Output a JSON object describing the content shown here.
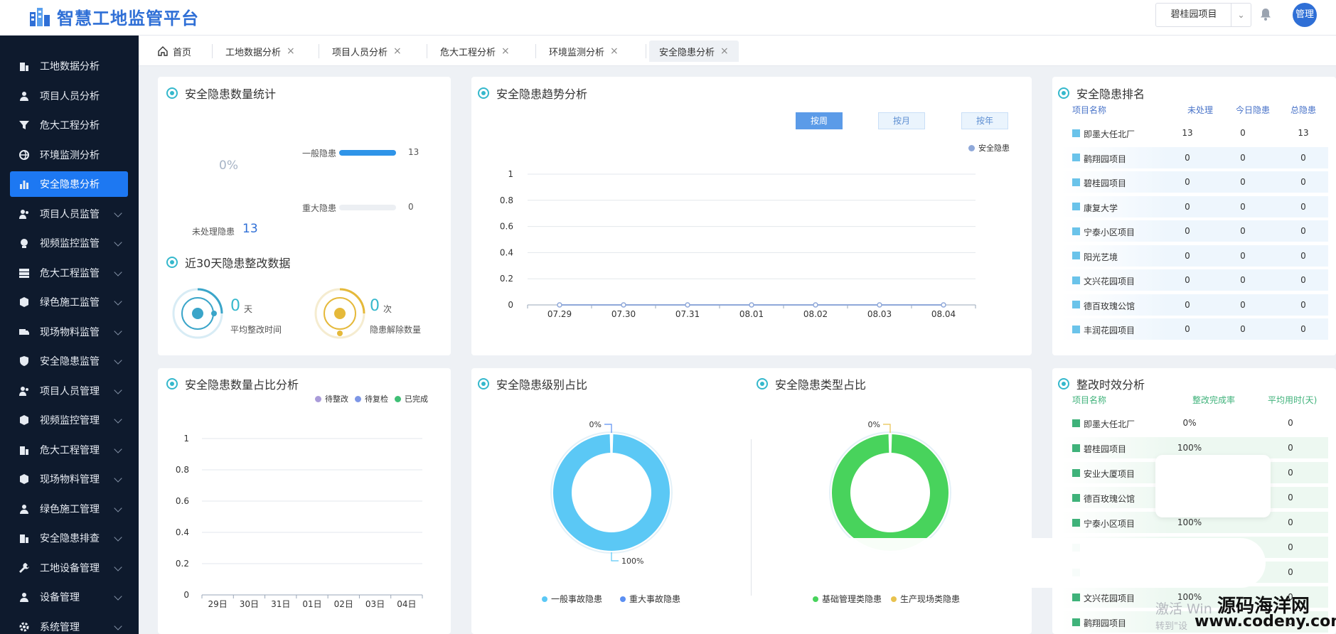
{
  "app": {
    "title": "智慧工地监管平台",
    "project": "碧桂园项目",
    "user": "管理"
  },
  "colors": {
    "sidebar_bg": "#0e1a2d",
    "accent": "#1d78f2",
    "teal": "#35b8cc",
    "donut_blue": "#5bc8f5",
    "donut_green": "#48d35c"
  },
  "sidebar": {
    "items": [
      {
        "label": "工地数据分析",
        "icon": "building-icon",
        "expandable": false
      },
      {
        "label": "项目人员分析",
        "icon": "user-icon",
        "expandable": false
      },
      {
        "label": "危大工程分析",
        "icon": "filter-icon",
        "expandable": false
      },
      {
        "label": "环境监测分析",
        "icon": "globe-icon",
        "expandable": false
      },
      {
        "label": "安全隐患分析",
        "icon": "bar-chart-icon",
        "expandable": false,
        "active": true
      },
      {
        "label": "项目人员监管",
        "icon": "users-icon",
        "expandable": true
      },
      {
        "label": "视频监控监管",
        "icon": "video-icon",
        "expandable": true
      },
      {
        "label": "危大工程监管",
        "icon": "server-icon",
        "expandable": true
      },
      {
        "label": "绿色施工监管",
        "icon": "cube-icon",
        "expandable": true
      },
      {
        "label": "现场物料监管",
        "icon": "truck-icon",
        "expandable": true
      },
      {
        "label": "安全隐患监管",
        "icon": "shield-icon",
        "expandable": true
      },
      {
        "label": "项目人员管理",
        "icon": "users-icon",
        "expandable": true
      },
      {
        "label": "视频监控管理",
        "icon": "cube-icon",
        "expandable": true
      },
      {
        "label": "危大工程管理",
        "icon": "building-icon",
        "expandable": true
      },
      {
        "label": "现场物料管理",
        "icon": "cube-icon",
        "expandable": true
      },
      {
        "label": "绿色施工管理",
        "icon": "user-icon",
        "expandable": true
      },
      {
        "label": "安全隐患排查",
        "icon": "building-icon",
        "expandable": true
      },
      {
        "label": "工地设备管理",
        "icon": "wrench-icon",
        "expandable": true
      },
      {
        "label": "设备管理",
        "icon": "user-icon",
        "expandable": true
      },
      {
        "label": "系统管理",
        "icon": "gear-icon",
        "expandable": true
      }
    ]
  },
  "tabs": [
    {
      "label": "首页",
      "closable": false
    },
    {
      "label": "工地数据分析",
      "closable": true
    },
    {
      "label": "项目人员分析",
      "closable": true
    },
    {
      "label": "危大工程分析",
      "closable": true
    },
    {
      "label": "环境监测分析",
      "closable": true
    },
    {
      "label": "安全隐患分析",
      "closable": true,
      "active": true
    }
  ],
  "stats": {
    "title": "安全隐患数量统计",
    "percent": "0%",
    "general": {
      "label": "一般隐患",
      "value": 13,
      "fill": 1.0
    },
    "major": {
      "label": "重大隐患",
      "value": 0,
      "fill": 0
    },
    "unprocessed_label": "未处理隐患",
    "unprocessed_value": "13"
  },
  "rect30": {
    "title": "近30天隐患整改数据",
    "avg": {
      "value": "0",
      "unit": "天",
      "label": "平均整改时间"
    },
    "resolved": {
      "value": "0",
      "unit": "次",
      "label": "隐患解除数量"
    }
  },
  "trend": {
    "title": "安全隐患趋势分析",
    "buttons": [
      "按周",
      "按月",
      "按年"
    ],
    "legend": "安全隐患"
  },
  "ranking": {
    "title": "安全隐患排名",
    "headers": [
      "项目名称",
      "未处理",
      "今日隐患",
      "总隐患"
    ],
    "rows": [
      [
        "即墨大任北厂",
        "13",
        "0",
        "13"
      ],
      [
        "鹳翔园项目",
        "0",
        "0",
        "0"
      ],
      [
        "碧桂园项目",
        "0",
        "0",
        "0"
      ],
      [
        "康复大学",
        "0",
        "0",
        "0"
      ],
      [
        "宁泰小区项目",
        "0",
        "0",
        "0"
      ],
      [
        "阳光艺境",
        "0",
        "0",
        "0"
      ],
      [
        "文兴花园项目",
        "0",
        "0",
        "0"
      ],
      [
        "德百玫瑰公馆",
        "0",
        "0",
        "0"
      ],
      [
        "丰润花园项目",
        "0",
        "0",
        "0"
      ]
    ]
  },
  "ratio": {
    "title": "安全隐患数量占比分析",
    "legend": [
      {
        "name": "待整改",
        "color": "#a99bd9"
      },
      {
        "name": "待复检",
        "color": "#7d96e6"
      },
      {
        "name": "已完成",
        "color": "#3fbf75"
      }
    ]
  },
  "level": {
    "title": "安全隐患级别占比",
    "label_top": "0%",
    "label_bottom": "100%",
    "legend": [
      {
        "name": "一般事故隐患",
        "color": "#5bc8f5"
      },
      {
        "name": "重大事故隐患",
        "color": "#5b8ff2"
      }
    ]
  },
  "type": {
    "title": "安全隐患类型占比",
    "label_top": "0%",
    "legend": [
      {
        "name": "基础管理类隐患",
        "color": "#48d35c"
      },
      {
        "name": "生产现场类隐患",
        "color": "#e8c24e"
      }
    ]
  },
  "rectify": {
    "title": "整改时效分析",
    "headers": [
      "项目名称",
      "整改完成率",
      "平均用时(天)"
    ],
    "rows": [
      [
        "即墨大任北厂",
        "0%",
        "0"
      ],
      [
        "碧桂园项目",
        "100%",
        "0"
      ],
      [
        "安业大厦项目",
        "",
        "0"
      ],
      [
        "德百玫瑰公馆",
        "",
        "0"
      ],
      [
        "宁泰小区项目",
        "100%",
        "0"
      ],
      [
        "",
        "",
        "0"
      ],
      [
        "",
        "",
        "0"
      ],
      [
        "文兴花园项目",
        "100%",
        "0"
      ],
      [
        "鹳翔园项目",
        "",
        "0"
      ]
    ]
  },
  "watermark": {
    "activate": "激活 Win",
    "goto": "转到\"设",
    "site_name": "源码海洋网",
    "site_url": "www.codeny.com"
  },
  "chart_data": [
    {
      "type": "line",
      "title": "安全隐患趋势分析",
      "categories": [
        "07.29",
        "07.30",
        "07.31",
        "08.01",
        "08.02",
        "08.03",
        "08.04"
      ],
      "series": [
        {
          "name": "安全隐患",
          "values": [
            0,
            0,
            0,
            0,
            0,
            0,
            0
          ]
        }
      ],
      "y_ticks": [
        "0",
        "0.2",
        "0.4",
        "0.6",
        "0.8",
        "1"
      ],
      "ylim": [
        0,
        1
      ],
      "grid": true,
      "legend": "top-right"
    },
    {
      "type": "bar",
      "title": "安全隐患数量占比分析",
      "categories": [
        "29日",
        "30日",
        "31日",
        "01日",
        "02日",
        "03日",
        "04日"
      ],
      "series": [
        {
          "name": "待整改",
          "values": [
            0,
            0,
            0,
            0,
            0,
            0,
            0
          ]
        },
        {
          "name": "待复检",
          "values": [
            0,
            0,
            0,
            0,
            0,
            0,
            0
          ]
        },
        {
          "name": "已完成",
          "values": [
            0,
            0,
            0,
            0,
            0,
            0,
            0
          ]
        }
      ],
      "y_ticks": [
        "0",
        "0.2",
        "0.4",
        "0.6",
        "0.8",
        "1"
      ],
      "ylim": [
        0,
        1
      ],
      "grid": true,
      "legend": "top-right"
    },
    {
      "type": "pie",
      "title": "安全隐患级别占比",
      "categories": [
        "一般事故隐患",
        "重大事故隐患"
      ],
      "values": [
        100,
        0
      ]
    },
    {
      "type": "pie",
      "title": "安全隐患类型占比",
      "categories": [
        "基础管理类隐患",
        "生产现场类隐患"
      ],
      "values": [
        100,
        0
      ]
    }
  ]
}
